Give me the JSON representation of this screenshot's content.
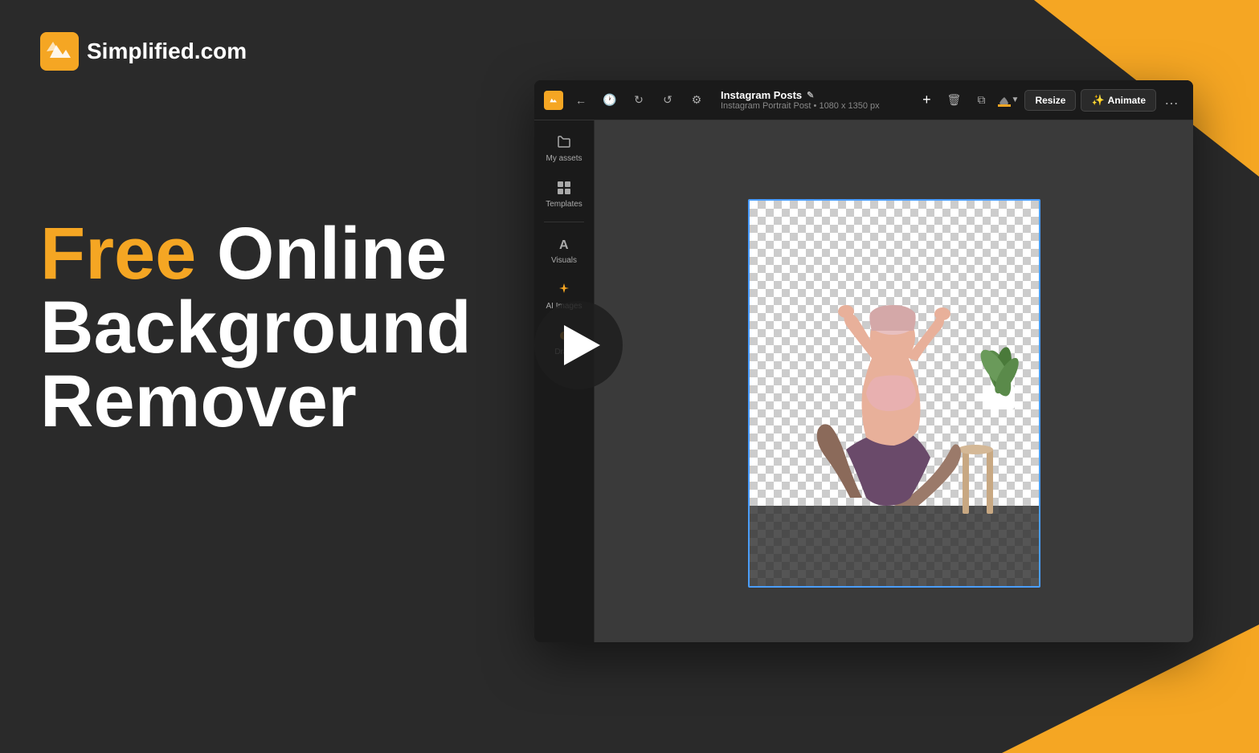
{
  "brand": {
    "name": "Simplified.com",
    "logo_alt": "Simplified logo"
  },
  "hero": {
    "line1_free": "Free",
    "line1_online": " Online",
    "line2": "Background",
    "line3": "Remover"
  },
  "app": {
    "title": "Instagram Posts",
    "subtitle": "Instagram Portrait Post • 1080 x 1350 px",
    "toolbar": {
      "resize_label": "Resize",
      "animate_label": "Animate",
      "more_label": "..."
    },
    "sidebar": {
      "items": [
        {
          "label": "My assets",
          "icon": "folder"
        },
        {
          "label": "Templates",
          "icon": "grid"
        },
        {
          "label": "Visuals",
          "icon": "A-text"
        },
        {
          "label": "AI Images",
          "icon": "sparkle"
        },
        {
          "label": "Draw",
          "icon": "pen"
        }
      ]
    }
  }
}
